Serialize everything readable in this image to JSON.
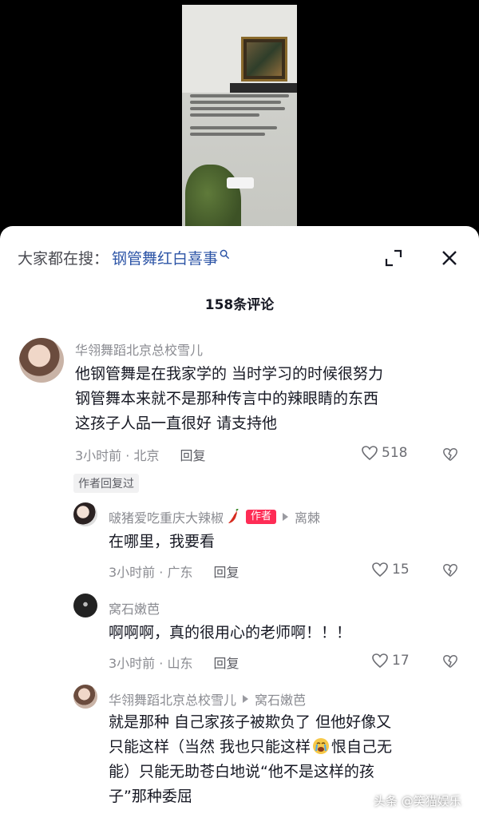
{
  "search": {
    "prefix": "大家都在搜：",
    "term": "钢管舞红白喜事"
  },
  "comment_count": "158条评论",
  "comments": [
    {
      "username": "华翎舞蹈北京总校雪儿",
      "lines": [
        "他钢管舞是在我家学的 当时学习的时候很努力",
        "钢管舞本来就不是那种传言中的辣眼睛的东西",
        "这孩子人品一直很好 请支持他"
      ],
      "time_location": "3小时前 · 北京",
      "reply_label": "回复",
      "likes": "518",
      "author_replied": "作者回复过"
    },
    {
      "username": "啵猪爱吃重庆大辣椒",
      "badge": "作者",
      "reply_to": "离棘",
      "text": "在哪里，我要看",
      "time_location": "3小时前 · 广东",
      "reply_label": "回复",
      "likes": "15"
    },
    {
      "username": "窝石嫩芭",
      "text": "啊啊啊，真的很用心的老师啊！！！",
      "time_location": "3小时前 · 山东",
      "reply_label": "回复",
      "likes": "17"
    },
    {
      "username": "华翎舞蹈北京总校雪儿",
      "reply_to": "窝石嫩芭",
      "line1": "就是那种 自己家孩子被欺负了 但他好像又",
      "line2a": "只能这样（当然 我也只能这样",
      "line2b": "恨自己无",
      "line3": "能）只能无助苍白地说“他不是这样的孩",
      "line4": "子”那种委屈"
    }
  ],
  "watermark": "头条 @笑猫娱乐",
  "colors": {
    "link": "#2c54a6",
    "badge": "#fe2c55",
    "meta": "#8a8b91",
    "text": "#161823"
  }
}
